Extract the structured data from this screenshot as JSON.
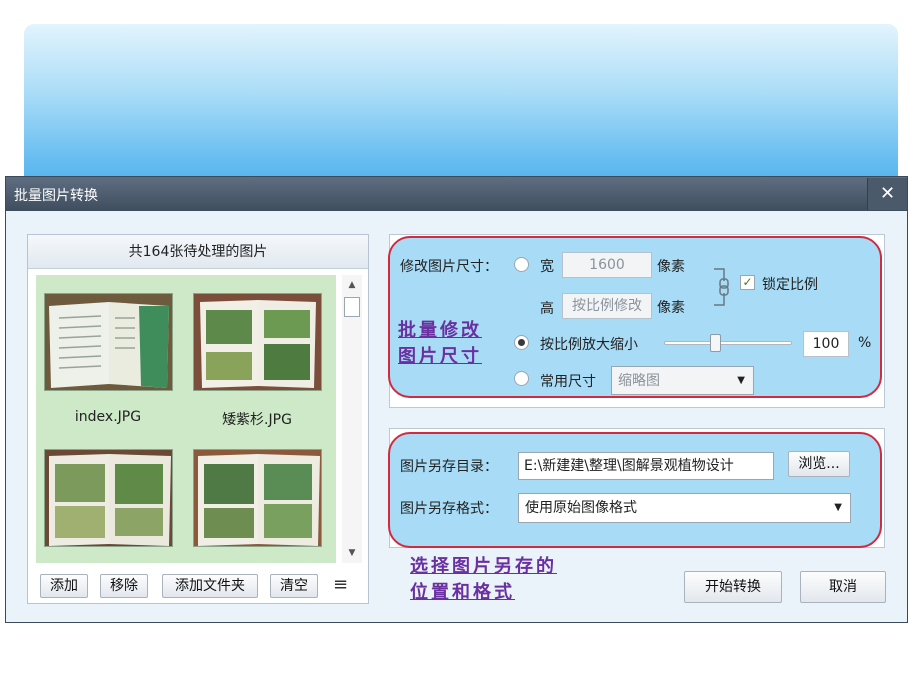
{
  "colors": {
    "banner_top": "#e3f4fd",
    "banner_bottom": "#3c9fe2",
    "highlight_fill": "#a7dbf6",
    "highlight_border": "#d22a3e",
    "annotation_text": "#6a2fa0"
  },
  "dialog": {
    "title": "批量图片转换",
    "close_label": "✕"
  },
  "file_list": {
    "header": "共164张待处理的图片",
    "items": [
      {
        "name": "index.JPG"
      },
      {
        "name": "矮紫杉.JPG"
      },
      {
        "name": ""
      },
      {
        "name": ""
      }
    ],
    "buttons": {
      "add": "添加",
      "remove": "移除",
      "add_folder": "添加文件夹",
      "clear": "清空"
    },
    "list_icon": "≡"
  },
  "resize": {
    "label": "修改图片尺寸：",
    "width_label": "宽",
    "width_value": "1600",
    "width_unit": "像素",
    "height_label": "高",
    "height_value": "按比例修改",
    "height_unit": "像素",
    "lock_label": "锁定比例",
    "lock_checked": true,
    "scale_label": "按比例放大缩小",
    "scale_value": "100",
    "scale_unit": "%",
    "scale_slider_fraction": 0.4,
    "common_label": "常用尺寸",
    "common_value": "缩略图",
    "selected_mode": "scale"
  },
  "save": {
    "dir_label": "图片另存目录：",
    "dir_value": "E:\\新建建\\整理\\图解景观植物设计 ",
    "browse": "浏览...",
    "format_label": "图片另存格式：",
    "format_value": "使用原始图像格式"
  },
  "actions": {
    "start": "开始转换",
    "cancel": "取消"
  },
  "annotations": {
    "resize_line1": "批量修改",
    "resize_line2": "图片尺寸",
    "save_line1": "选择图片另存的",
    "save_line2": "位置和格式"
  }
}
